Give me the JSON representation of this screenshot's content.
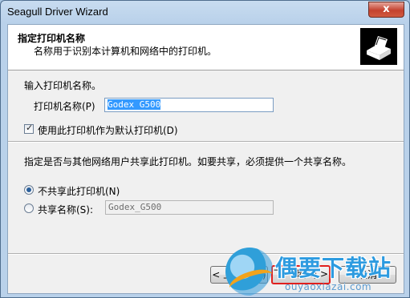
{
  "window": {
    "title": "Seagull Driver Wizard",
    "close_glyph": "x"
  },
  "header": {
    "title": "指定打印机名称",
    "subtitle": "名称用于识别本计算机和网络中的打印机。",
    "icon": "printer-icon"
  },
  "printer_name": {
    "prompt": "输入打印机名称。",
    "label": "打印机名称(P)",
    "value": "Godex G500"
  },
  "default_printer": {
    "label": "使用此打印机作为默认打印机(D)",
    "checked": true
  },
  "sharing": {
    "prompt": "指定是否与其他网络用户共享此打印机。如要共享，必须提供一个共享名称。",
    "no_share_label": "不共享此打印机(N)",
    "share_label": "共享名称(S):",
    "share_name_value": "Godex_G500",
    "selected": "no_share"
  },
  "buttons": {
    "back_label": "< 上一步(B)",
    "next_label": "下一步(N) >",
    "cancel_label": "取消"
  },
  "watermark": {
    "text": "偶要下载站",
    "url": "ouyaoxiazai.com"
  },
  "colors": {
    "accent": "#3399ff",
    "focus_border": "#e0201e",
    "watermark_blue": "#2d9be0"
  }
}
